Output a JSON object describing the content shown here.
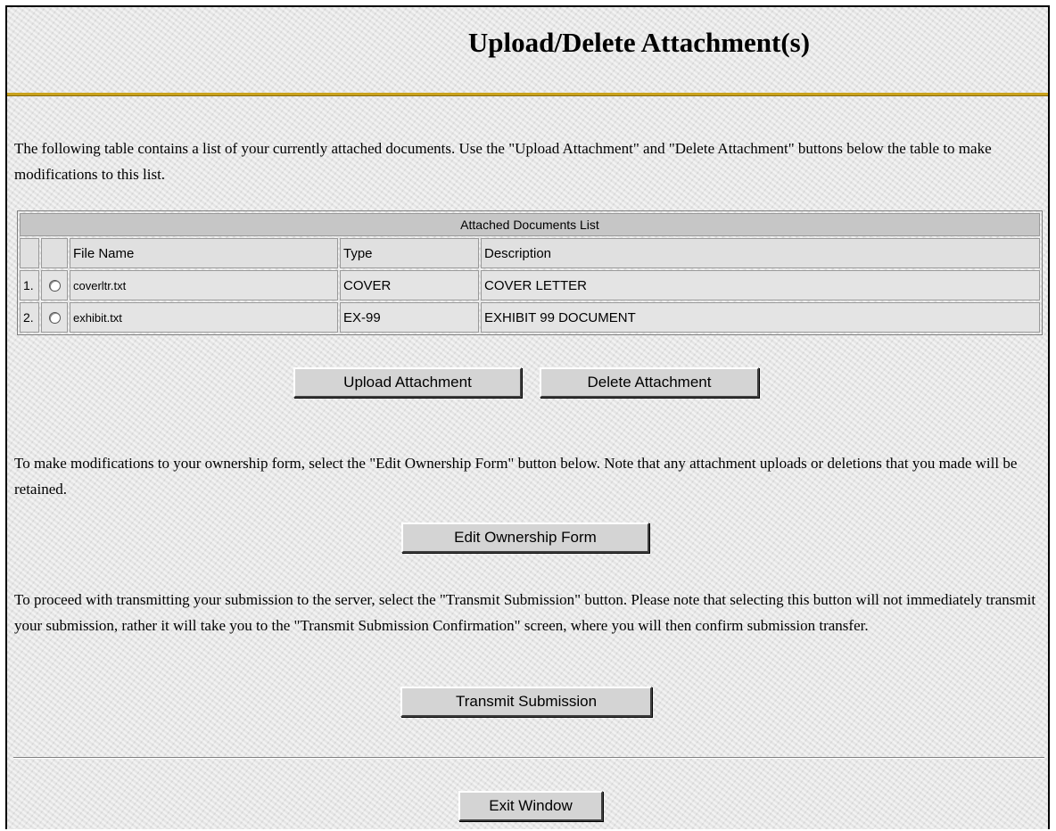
{
  "page": {
    "title": "Upload/Delete Attachment(s)"
  },
  "intro_text": "The following table contains a list of your currently attached documents. Use the \"Upload Attachment\" and \"Delete Attachment\" buttons below the table to make modifications to this list.",
  "attachments_table": {
    "caption": "Attached Documents List",
    "columns": [
      "File Name",
      "Type",
      "Description"
    ],
    "rows": [
      {
        "index": "1.",
        "file_name": "coverltr.txt",
        "type": "COVER",
        "description": "COVER LETTER"
      },
      {
        "index": "2.",
        "file_name": "exhibit.txt",
        "type": "EX-99",
        "description": "EXHIBIT 99 DOCUMENT"
      }
    ]
  },
  "buttons": {
    "upload": "Upload Attachment",
    "delete": "Delete Attachment",
    "edit_form": "Edit Ownership Form",
    "transmit": "Transmit Submission",
    "exit": "Exit Window"
  },
  "edit_text": "To make modifications to your ownership form, select the \"Edit Ownership Form\" button below. Note that any attachment uploads or deletions that you made will be retained.",
  "transmit_text": "To proceed with transmitting your submission to the server, select the \"Transmit Submission\" button. Please note that selecting this button will not immediately transmit your submission, rather it will take you to the \"Transmit Submission Confirmation\" screen, where you will then confirm submission transfer.",
  "colors": {
    "title_rule": "#c9a21c",
    "button_face": "#d4d4d4",
    "table_caption_bg": "#c6c6c6"
  }
}
